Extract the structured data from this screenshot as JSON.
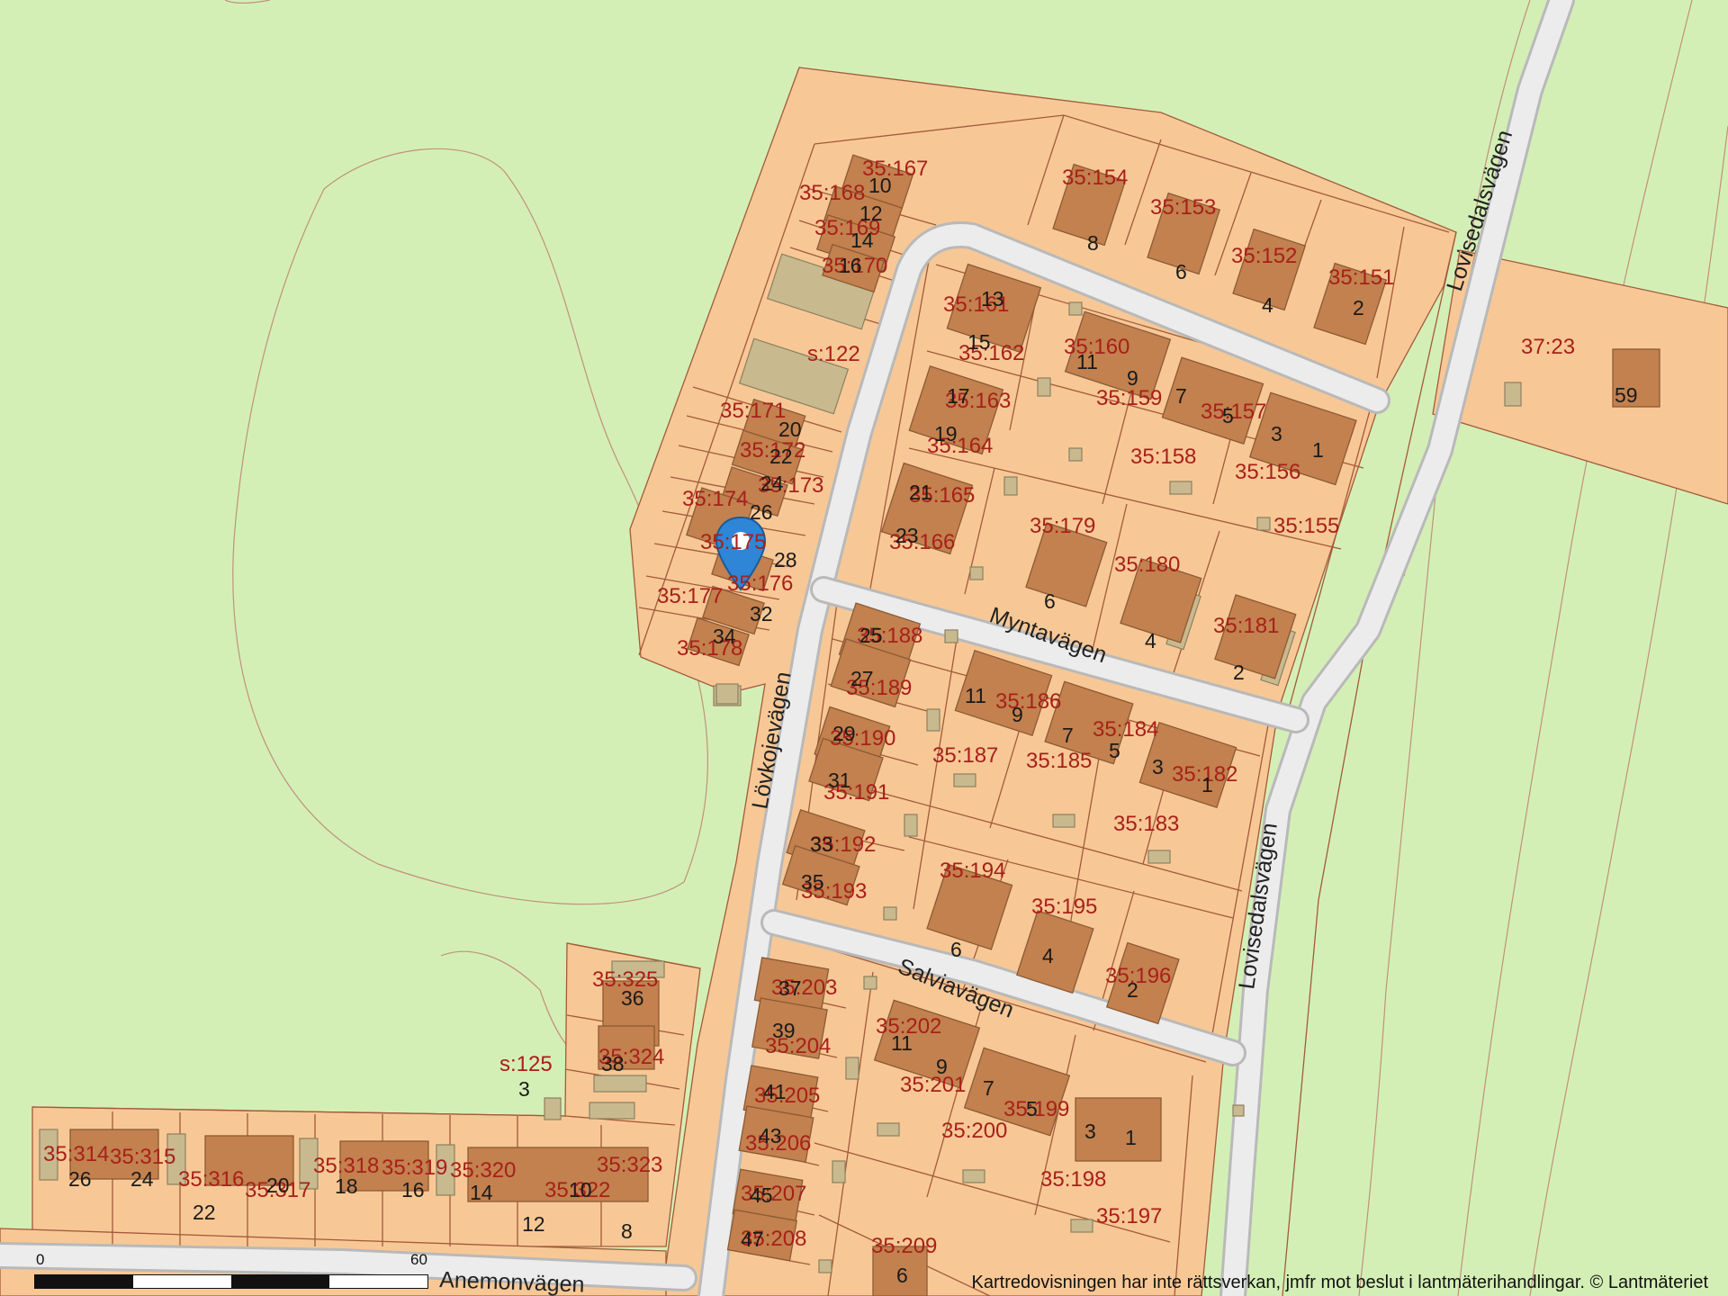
{
  "map": {
    "colors": {
      "background": "#d4efb6",
      "plot": "#f7c896",
      "building": "#c2814e",
      "shed": "#c9b98e",
      "road": "#ececec",
      "boundary": "#a35a3a",
      "parcel_label": "#a8201a",
      "marker": "#2f86d6"
    },
    "marker": {
      "icon": "location-pin-icon"
    },
    "roads": [
      {
        "name": "Lövkojevägen"
      },
      {
        "name": "Myntavägen"
      },
      {
        "name": "Salviavägen"
      },
      {
        "name": "Lovisedalsvägen"
      },
      {
        "name": "Anemonvägen"
      }
    ],
    "road_extra": "Lovisedalsvägen",
    "parcels": [
      "35:167",
      "35:168",
      "35:169",
      "35:170",
      "s:122",
      "35:171",
      "35:172",
      "35:173",
      "35:174",
      "35:175",
      "35:176",
      "35:177",
      "35:178",
      "35:154",
      "35:153",
      "35:152",
      "35:151",
      "37:23",
      "35:161",
      "35:162",
      "35:160",
      "35:159",
      "35:157",
      "35:163",
      "35:164",
      "35:158",
      "35:156",
      "35:165",
      "35:166",
      "35:155",
      "35:179",
      "35:180",
      "35:181",
      "35:188",
      "35:189",
      "35:186",
      "35:184",
      "35:190",
      "35:187",
      "35:185",
      "35:182",
      "35:191",
      "35:183",
      "35:192",
      "35:193",
      "35:194",
      "35:195",
      "35:196",
      "35:325",
      "35:324",
      "s:125",
      "35:203",
      "35:204",
      "35:202",
      "35:205",
      "35:201",
      "35:199",
      "35:206",
      "35:200",
      "35:207",
      "35:198",
      "35:197",
      "35:208",
      "35:209",
      "35:314",
      "35:315",
      "35:316",
      "35:317",
      "35:318",
      "35:319",
      "35:320",
      "35:322",
      "35:323"
    ],
    "addresses": [
      "10",
      "12",
      "14",
      "16",
      "20",
      "22",
      "24",
      "26",
      "28",
      "32",
      "34",
      "8",
      "6",
      "4",
      "2",
      "59",
      "13",
      "15",
      "11",
      "9",
      "7",
      "5",
      "3",
      "1",
      "17",
      "19",
      "21",
      "23",
      "6",
      "4",
      "2",
      "25",
      "27",
      "11",
      "9",
      "7",
      "5",
      "3",
      "1",
      "29",
      "31",
      "33",
      "35",
      "6",
      "4",
      "2",
      "36",
      "38",
      "3",
      "37",
      "39",
      "11",
      "9",
      "41",
      "7",
      "5",
      "43",
      "3",
      "1",
      "45",
      "47",
      "6",
      "26",
      "24",
      "20",
      "22",
      "18",
      "16",
      "14",
      "12",
      "10",
      "8"
    ],
    "scale": {
      "start": "0",
      "end": "60 m"
    },
    "disclaimer": "Kartredovisningen har inte rättsverkan, jmfr mot beslut i lantmäterihandlingar. © Lantmäteriet"
  }
}
